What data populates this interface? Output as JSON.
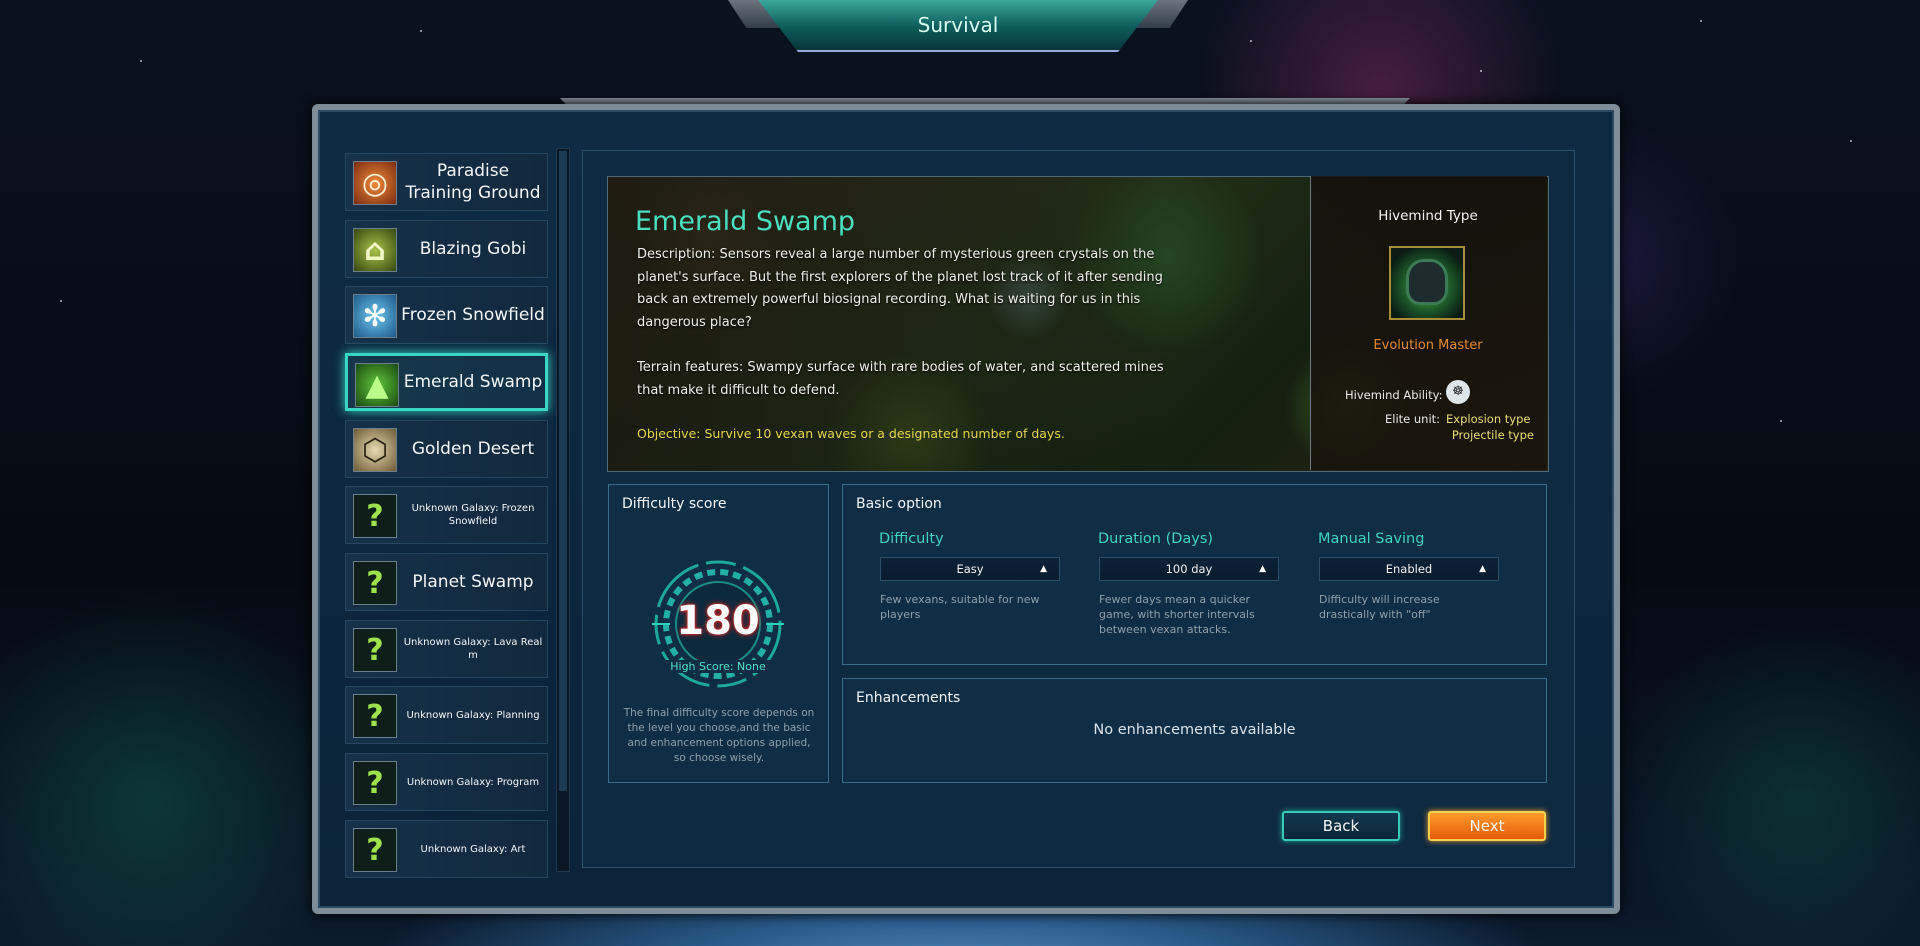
{
  "header": {
    "title": "Survival"
  },
  "levels": [
    {
      "label": "Paradise Training Ground",
      "icon": "spiral-icon",
      "small": false,
      "selected": false
    },
    {
      "label": "Blazing Gobi",
      "icon": "desert-dome-icon",
      "small": false,
      "selected": false
    },
    {
      "label": "Frozen Snowfield",
      "icon": "snowflake-gear-icon",
      "small": false,
      "selected": false
    },
    {
      "label": "Emerald Swamp",
      "icon": "mountain-icon",
      "small": false,
      "selected": true
    },
    {
      "label": "Golden Desert",
      "icon": "hex-shield-icon",
      "small": false,
      "selected": false
    },
    {
      "label": "Unknown Galaxy: Frozen Snowfield",
      "icon": "question-icon",
      "small": true,
      "selected": false
    },
    {
      "label": "Planet Swamp",
      "icon": "question-icon",
      "small": false,
      "selected": false
    },
    {
      "label": "Unknown Galaxy: Lava Real m",
      "icon": "question-icon",
      "small": true,
      "selected": false
    },
    {
      "label": "Unknown Galaxy: Planning",
      "icon": "question-icon",
      "small": true,
      "selected": false
    },
    {
      "label": "Unknown Galaxy: Program",
      "icon": "question-icon",
      "small": true,
      "selected": false
    },
    {
      "label": "Unknown Galaxy: Art",
      "icon": "question-icon",
      "small": true,
      "selected": false
    }
  ],
  "map": {
    "title": "Emerald Swamp",
    "description": "Description: Sensors reveal a large number of mysterious green crystals on the planet's surface. But the first explorers of the planet lost track of it after sending back an extremely powerful biosignal recording. What is waiting for us in this dangerous place?",
    "terrain": "Terrain features: Swampy surface with rare bodies of water, and scattered mines that make it difficult to defend.",
    "objective": "Objective: Survive 10 vexan waves or a designated number of days."
  },
  "hivemind": {
    "title": "Hivemind Type",
    "name": "Evolution Master",
    "ability_label": "Hivemind Ability:",
    "elite_label": "Elite unit:",
    "elite_types": [
      "Explosion type",
      "Projectile type"
    ]
  },
  "difficulty_score": {
    "title": "Difficulty score",
    "value": "180",
    "high_score": "High Score: None",
    "note": "The final difficulty score depends on the level you choose,and the basic and enhancement options applied, so choose wisely."
  },
  "basic_option": {
    "title": "Basic option",
    "options": [
      {
        "label": "Difficulty",
        "value": "Easy",
        "note": "Few vexans, suitable for new players"
      },
      {
        "label": "Duration (Days)",
        "value": "100 day",
        "note": "Fewer days mean a quicker game, with shorter intervals between vexan attacks."
      },
      {
        "label": "Manual Saving",
        "value": "Enabled",
        "note": "Difficulty will increase drastically with \"off\""
      }
    ]
  },
  "enhancements": {
    "title": "Enhancements",
    "empty": "No enhancements available"
  },
  "buttons": {
    "back": "Back",
    "next": "Next"
  },
  "colors": {
    "accent": "#3fd3c0",
    "selected_border": "#39d6c4",
    "next_button": "#ff8a1e",
    "gauge_value_glow": "#d9221c"
  }
}
